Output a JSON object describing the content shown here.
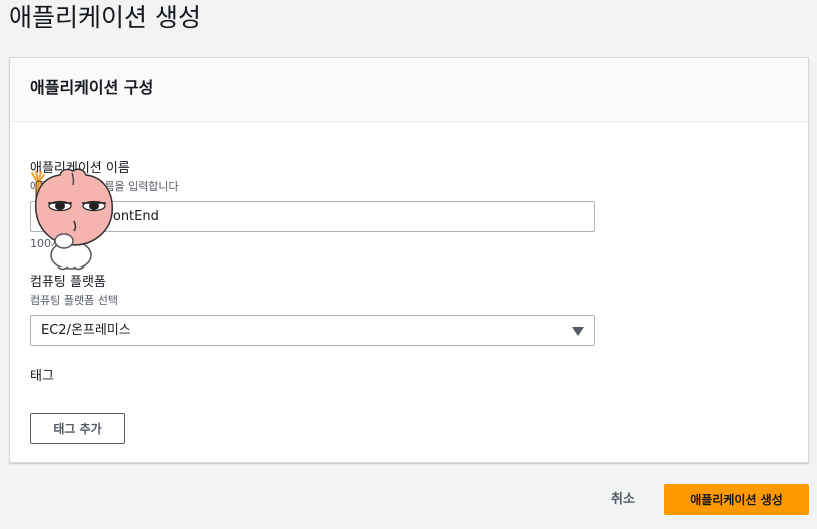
{
  "page": {
    "title": "애플리케이션 생성"
  },
  "panel": {
    "title": "애플리케이션 구성"
  },
  "app_name": {
    "label": "애플리케이션 이름",
    "description": "애플리케이션 이름을 입력합니다",
    "value": "Backend-FrontEnd",
    "visible_value_fragment": "tEnd",
    "constraint": "100자 제한"
  },
  "compute_platform": {
    "label": "컴퓨팅 플랫폼",
    "description": "컴퓨팅 플랫폼 선택",
    "selected": "EC2/온프레미스"
  },
  "tags": {
    "label": "태그",
    "add_button": "태그 추가"
  },
  "footer": {
    "cancel_label": "취소",
    "create_label": "애플리케이션 생성"
  },
  "icons": {
    "select_arrow": "caret-down-icon",
    "sticker": "apeach-sticker-icon"
  },
  "colors": {
    "primary_button": "#ff9900",
    "background": "#f2f3f3",
    "panel": "#ffffff",
    "border": "#aab7b8"
  }
}
